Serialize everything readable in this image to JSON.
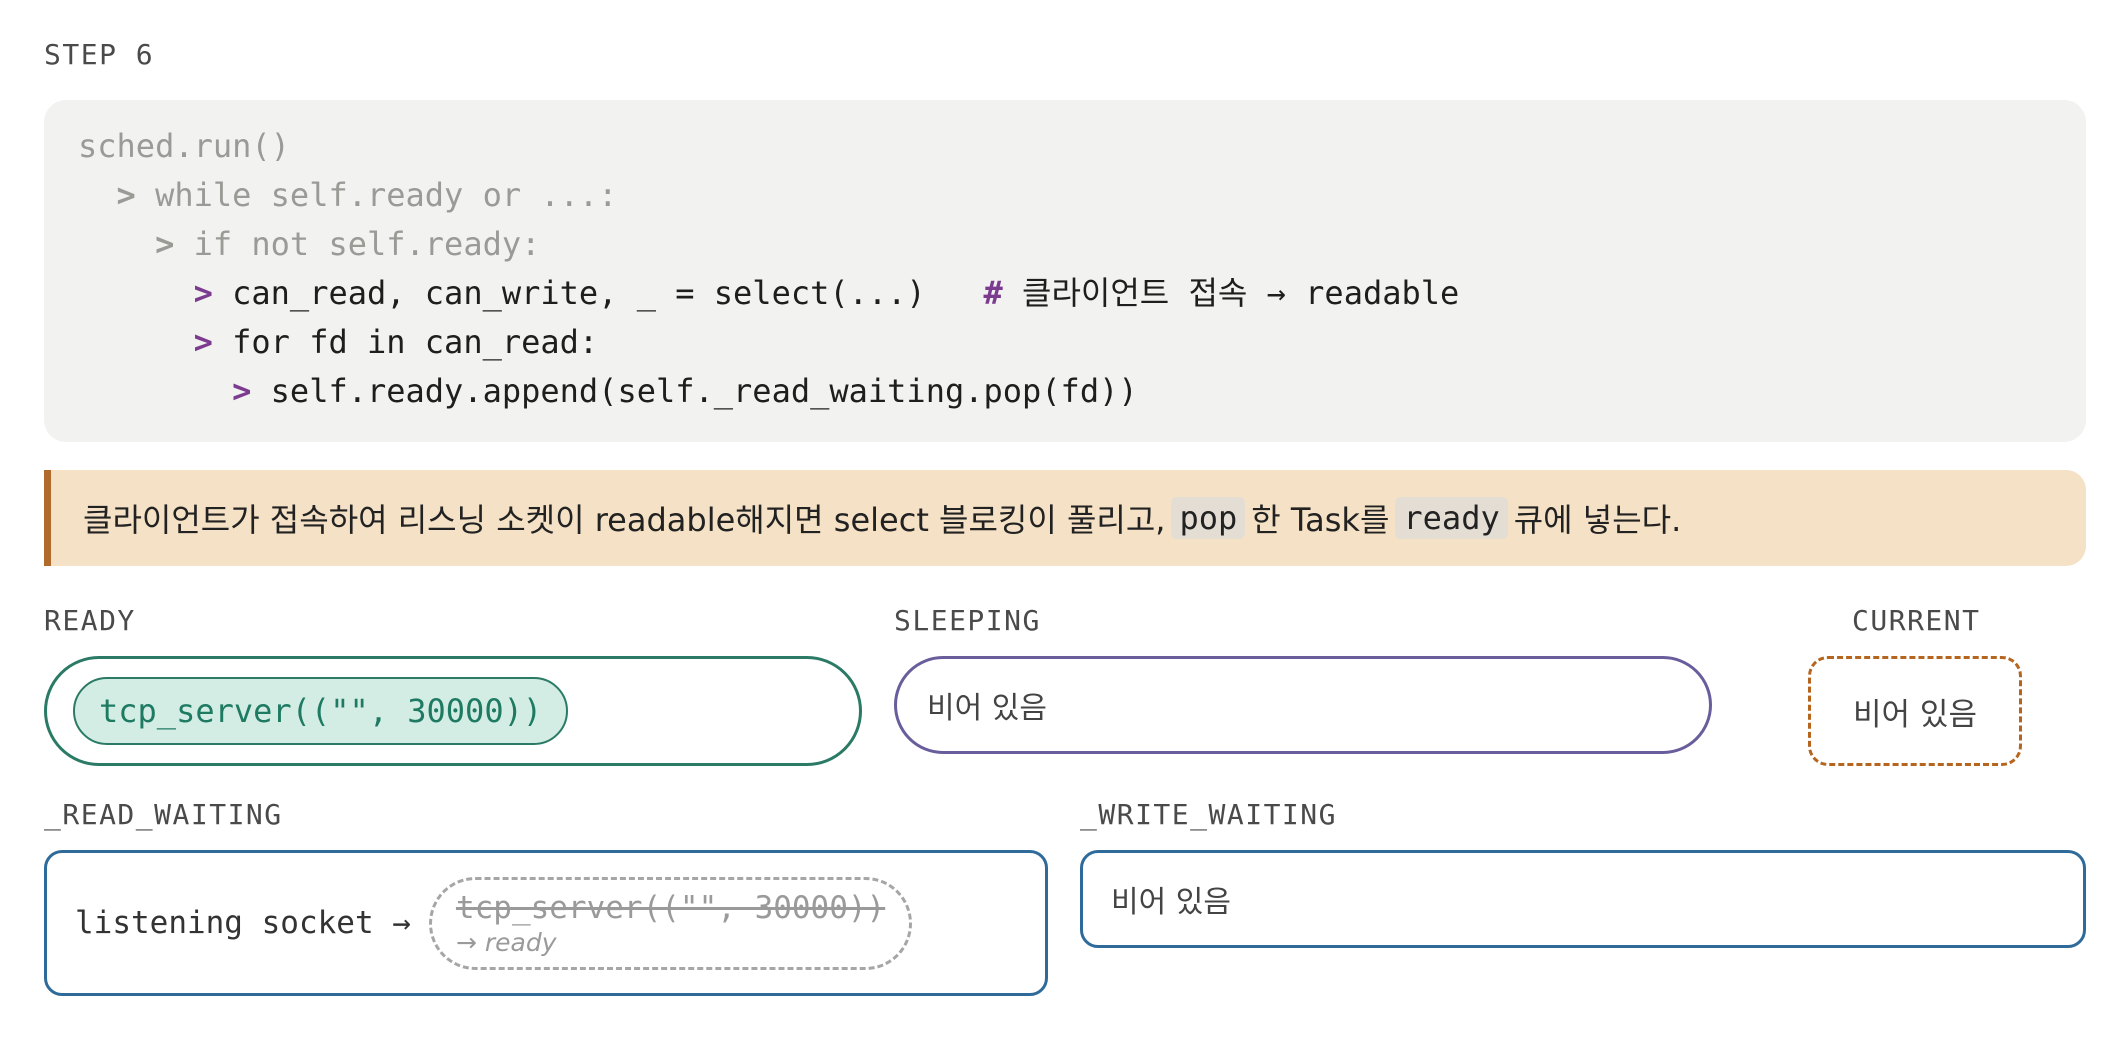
{
  "step": "STEP 6",
  "code_lines": [
    {
      "indent": "",
      "marker": "",
      "text": "sched.run()",
      "active": false,
      "comment": ""
    },
    {
      "indent": "  ",
      "marker": ">",
      "text": " while self.ready or ...:",
      "active": false,
      "comment": ""
    },
    {
      "indent": "    ",
      "marker": ">",
      "text": " if not self.ready:",
      "active": false,
      "comment": ""
    },
    {
      "indent": "      ",
      "marker": ">",
      "text": " can_read, can_write, _ = select(...)   ",
      "active": true,
      "comment_mark": "#",
      "comment": " 클라이언트 접속 → readable"
    },
    {
      "indent": "      ",
      "marker": ">",
      "text": " for fd in can_read:",
      "active": true,
      "comment": ""
    },
    {
      "indent": "        ",
      "marker": ">",
      "text": " self.ready.append(self._read_waiting.pop(fd))",
      "active": true,
      "comment": ""
    }
  ],
  "note": {
    "part1": "클라이언트가 접속하여 리스닝 소켓이 readable해지면 select 블로킹이 풀리고,",
    "code1": "pop",
    "part2": "한 Task를",
    "code2": "ready",
    "part3": "큐에 넣는다."
  },
  "ready": {
    "label": "READY",
    "task": "tcp_server((\"\", 30000))"
  },
  "sleeping": {
    "label": "SLEEPING",
    "empty": "비어 있음"
  },
  "current": {
    "label": "CURRENT",
    "empty": "비어 있음"
  },
  "read_waiting": {
    "label": "_READ_WAITING",
    "key": "listening socket →",
    "task": "tcp_server((\"\", 30000))",
    "status": "→ ready"
  },
  "write_waiting": {
    "label": "_WRITE_WAITING",
    "empty": "비어 있음"
  },
  "colors": {
    "ready": "#2a7a66",
    "sleeping": "#6a5d9c",
    "current": "#b5651d",
    "waiting": "#2f6b9a",
    "marker": "#7b3b8f",
    "note_bg": "#f4e1c6"
  }
}
